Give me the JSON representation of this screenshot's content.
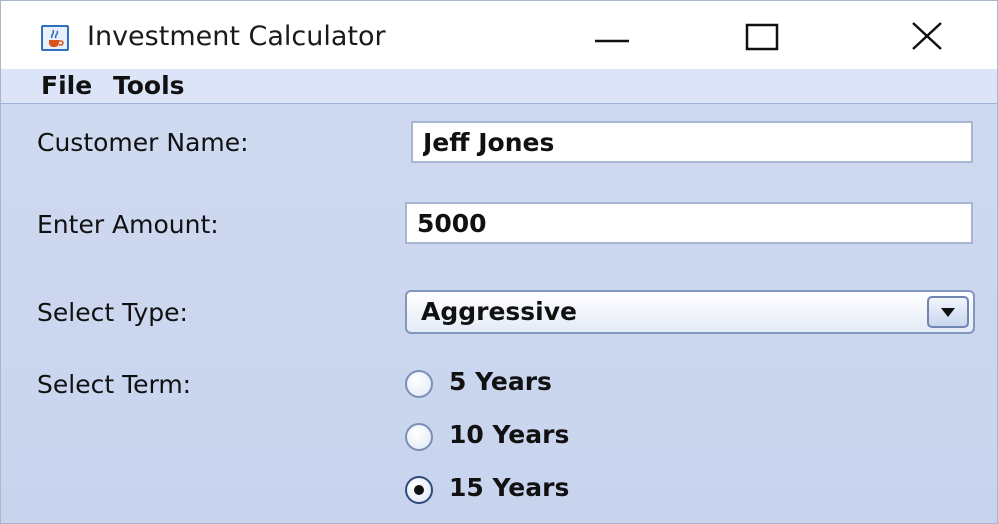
{
  "window": {
    "title": "Investment Calculator",
    "icon": "java-cup-icon",
    "controls": [
      "minimize-icon",
      "maximize-icon",
      "close-icon"
    ]
  },
  "menubar": {
    "items": [
      {
        "label": "File"
      },
      {
        "label": "Tools"
      }
    ]
  },
  "form": {
    "customer_name": {
      "label": "Customer Name:",
      "value": "Jeff Jones"
    },
    "amount": {
      "label": "Enter Amount:",
      "value": "5000"
    },
    "type": {
      "label": "Select Type:",
      "selected": "Aggressive"
    },
    "term": {
      "label": "Select Term:",
      "options": [
        {
          "label": "5 Years",
          "checked": false
        },
        {
          "label": "10 Years",
          "checked": false
        },
        {
          "label": "15 Years",
          "checked": true
        }
      ]
    }
  },
  "colors": {
    "panel_bg": "#ccd8ef",
    "menubar_bg": "#dbe5f7",
    "field_border": "#a7b7d3"
  }
}
